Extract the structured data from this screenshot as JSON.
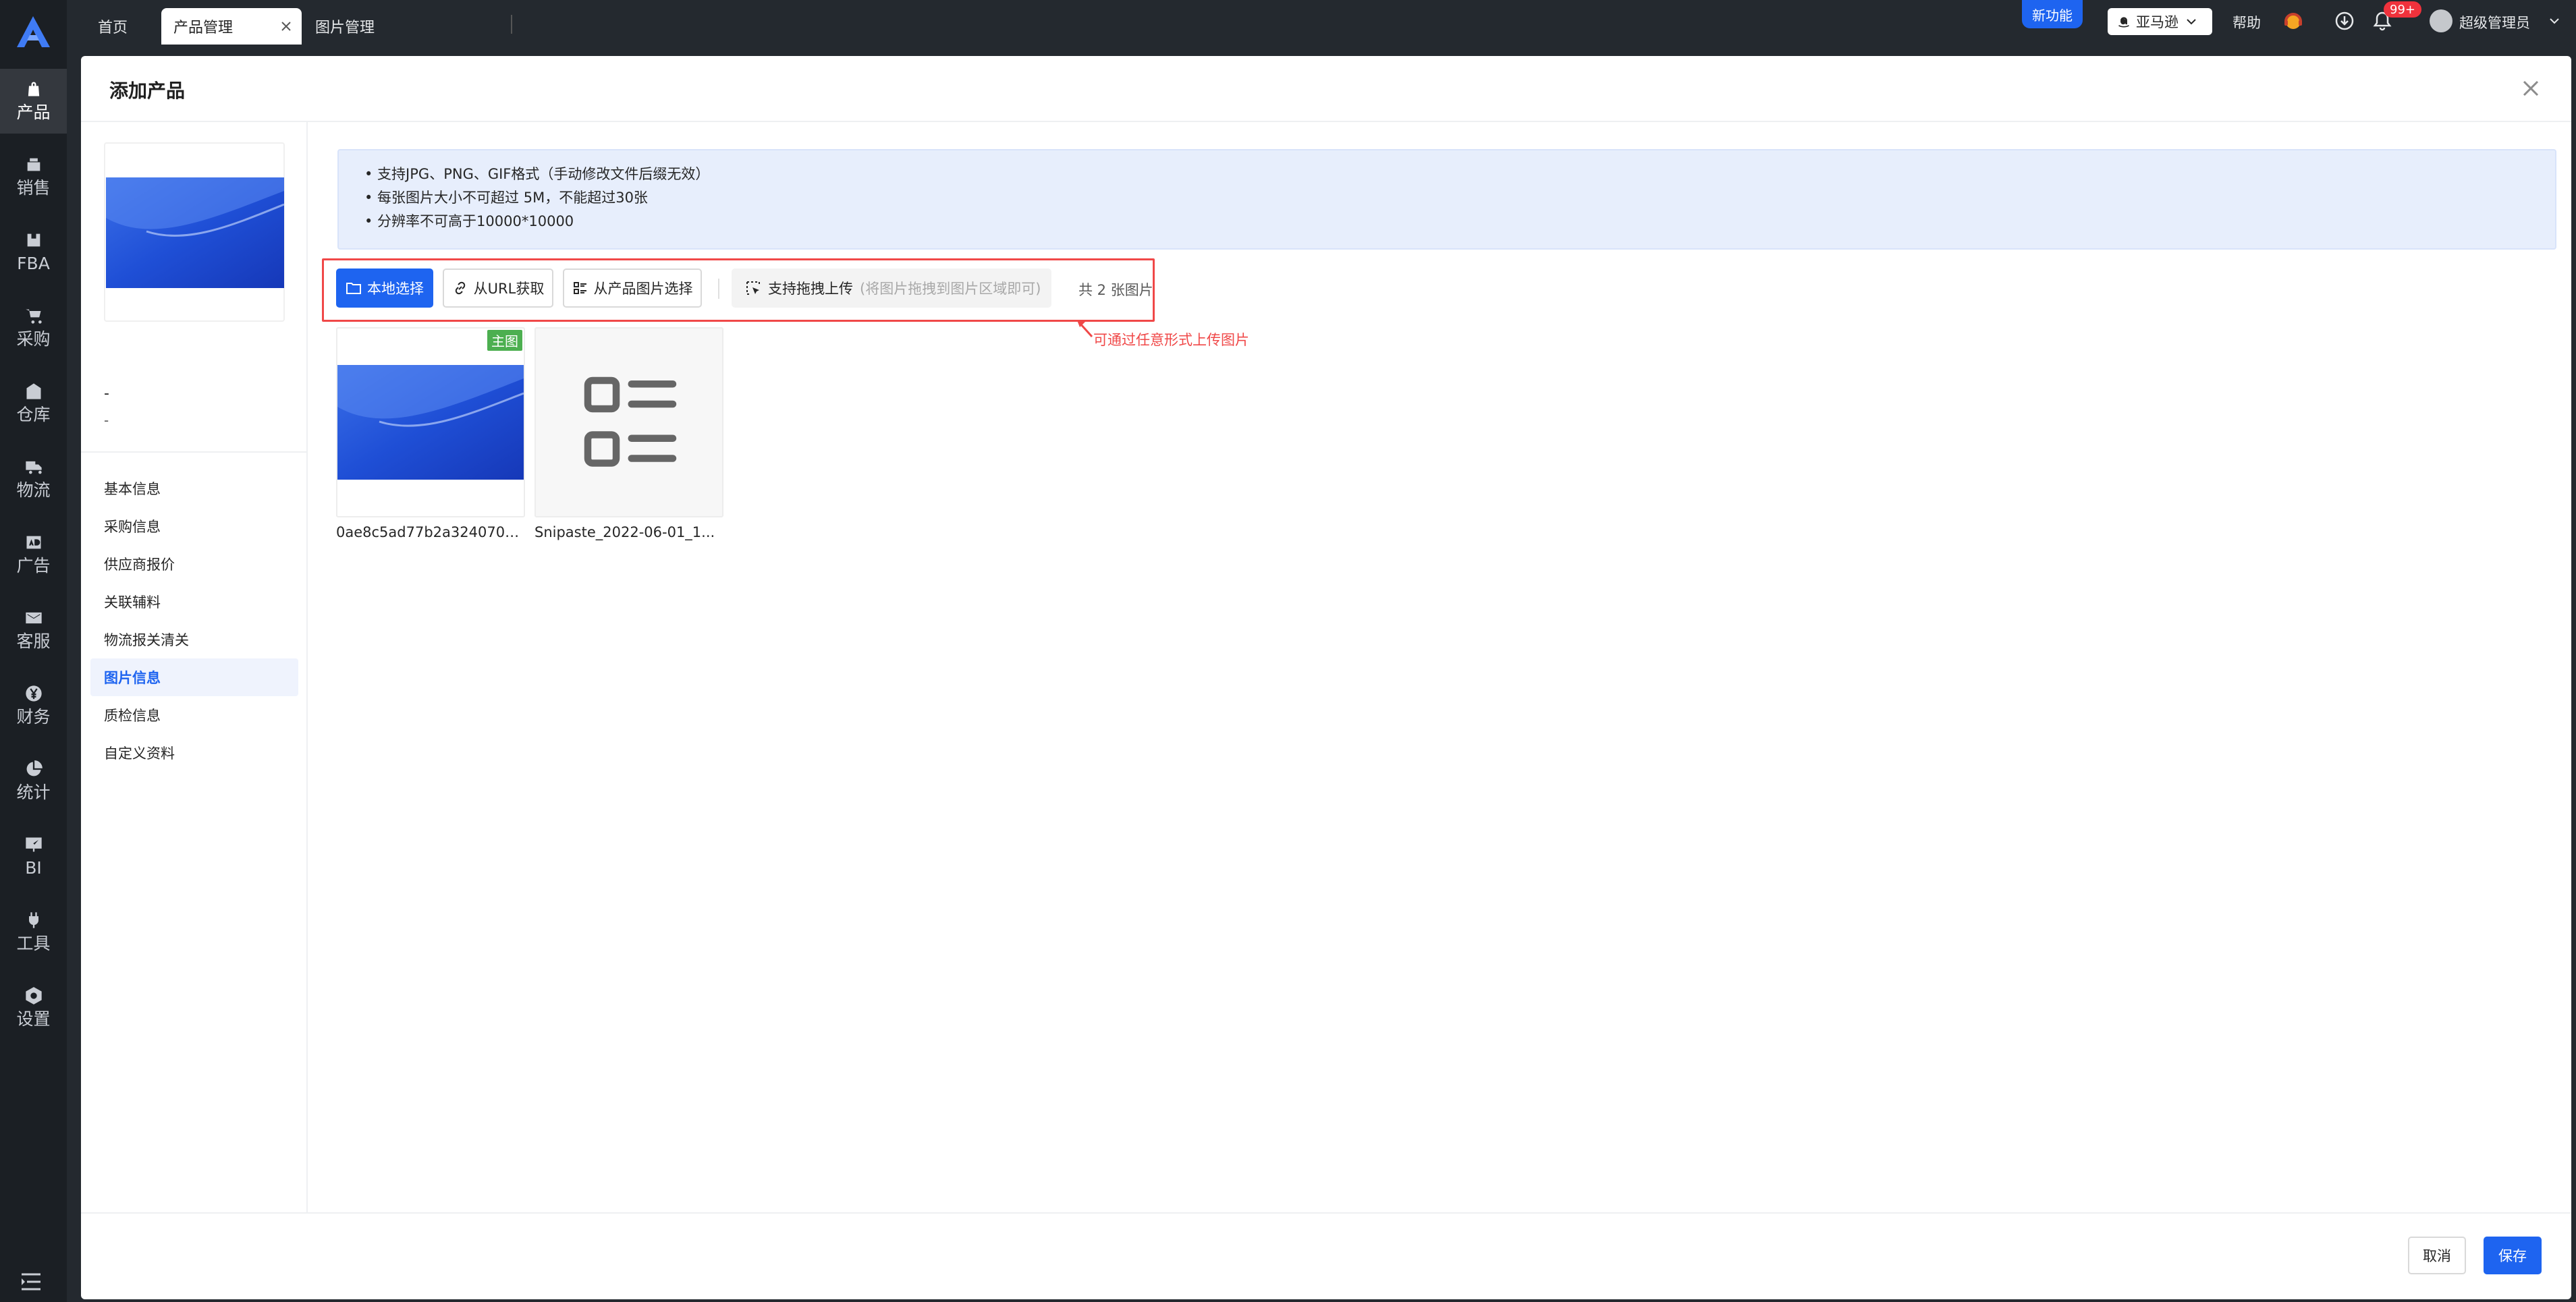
{
  "app": {
    "brand_color": "#1e64f0",
    "logo_icon": "brand-logo-icon"
  },
  "sidebar": {
    "items": [
      {
        "label": "产品",
        "icon": "bag-icon"
      },
      {
        "label": "销售",
        "icon": "cash-register-icon"
      },
      {
        "label": "FBA",
        "icon": "box-icon"
      },
      {
        "label": "采购",
        "icon": "cart-icon"
      },
      {
        "label": "仓库",
        "icon": "warehouse-icon"
      },
      {
        "label": "物流",
        "icon": "truck-icon"
      },
      {
        "label": "广告",
        "icon": "ad-icon"
      },
      {
        "label": "客服",
        "icon": "mail-icon"
      },
      {
        "label": "财务",
        "icon": "yen-icon"
      },
      {
        "label": "统计",
        "icon": "pie-chart-icon"
      },
      {
        "label": "BI",
        "icon": "chart-board-icon"
      },
      {
        "label": "工具",
        "icon": "plug-icon"
      },
      {
        "label": "设置",
        "icon": "hexagon-gear-icon"
      }
    ]
  },
  "topbar": {
    "tabs": [
      {
        "label": "首页"
      },
      {
        "label": "产品管理"
      },
      {
        "label": "图片管理"
      }
    ],
    "new_feature": "新功能",
    "marketplace": "亚马逊",
    "help": "帮助",
    "notification_count": "99+",
    "user": "超级管理员"
  },
  "modal": {
    "title": "添加产品",
    "preview_line1": "-",
    "preview_line2": "-",
    "nav": [
      {
        "label": "基本信息"
      },
      {
        "label": "采购信息"
      },
      {
        "label": "供应商报价"
      },
      {
        "label": "关联辅料"
      },
      {
        "label": "物流报关清关"
      },
      {
        "label": "图片信息"
      },
      {
        "label": "质检信息"
      },
      {
        "label": "自定义资料"
      }
    ],
    "notice": [
      "• 支持JPG、PNG、GIF格式（手动修改文件后缀无效）",
      "• 每张图片大小不可超过 5M，不能超过30张",
      "• 分辨率不可高于10000*10000"
    ],
    "buttons": {
      "local_select": "本地选择",
      "from_url": "从URL获取",
      "from_product": "从产品图片选择"
    },
    "drop_zone": {
      "label": "支持拖拽上传",
      "hint": "(将图片拖拽到图片区域即可)"
    },
    "image_count": "共 2 张图片",
    "annotation": "可通过任意形式上传图片",
    "images": [
      {
        "name": "0ae8c5ad77b2a3240706...",
        "tag": "主图"
      },
      {
        "name": "Snipaste_2022-06-01_1..."
      }
    ],
    "footer": {
      "cancel": "取消",
      "save": "保存"
    }
  }
}
